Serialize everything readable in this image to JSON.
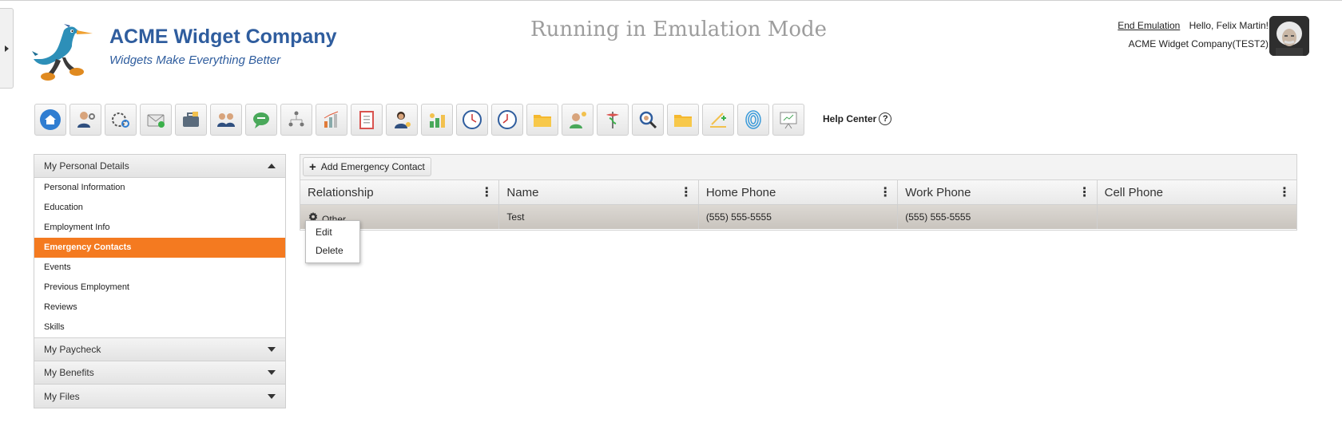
{
  "header": {
    "company_name": "ACME Widget Company",
    "tagline": "Widgets Make Everything Better",
    "emulation_title": "Running in Emulation Mode",
    "end_emulation": "End Emulation",
    "greeting": "Hello, Felix Martin!",
    "company_context": "ACME Widget Company(TEST2)"
  },
  "toolbar": {
    "icons": [
      "home-icon",
      "employee-settings-icon",
      "clock-settings-icon",
      "mail-icon",
      "briefcase-icon",
      "team-icon",
      "chat-icon",
      "org-chart-icon",
      "reports-chart-icon",
      "checklist-icon",
      "support-agent-icon",
      "benefits-icon",
      "time-clock-icon",
      "timesheet-clock-icon",
      "folder-icon",
      "idea-person-icon",
      "medical-icon",
      "search-icon",
      "documents-folder-icon",
      "training-icon",
      "fingerprint-icon",
      "presentation-icon"
    ],
    "help_label": "Help Center",
    "help_glyph": "?"
  },
  "sidebar": {
    "section_title": "My Personal Details",
    "items": [
      {
        "label": "Personal Information"
      },
      {
        "label": "Education"
      },
      {
        "label": "Employment Info"
      },
      {
        "label": "Emergency Contacts",
        "active": true
      },
      {
        "label": "Events"
      },
      {
        "label": "Previous Employment"
      },
      {
        "label": "Reviews"
      },
      {
        "label": "Skills"
      }
    ],
    "collapsed": [
      {
        "label": "My Paycheck"
      },
      {
        "label": "My Benefits"
      },
      {
        "label": "My Files"
      }
    ]
  },
  "grid": {
    "add_button": "Add Emergency Contact",
    "columns": [
      "Relationship",
      "Name",
      "Home Phone",
      "Work Phone",
      "Cell Phone"
    ],
    "rows": [
      {
        "relationship": "Other",
        "name": "Test",
        "home_phone": "(555) 555-5555",
        "work_phone": "(555) 555-5555",
        "cell_phone": ""
      }
    ]
  },
  "context_menu": {
    "items": [
      "Edit",
      "Delete"
    ]
  },
  "colors": {
    "brand_blue": "#2f5d9e",
    "active_orange": "#f47a20"
  }
}
